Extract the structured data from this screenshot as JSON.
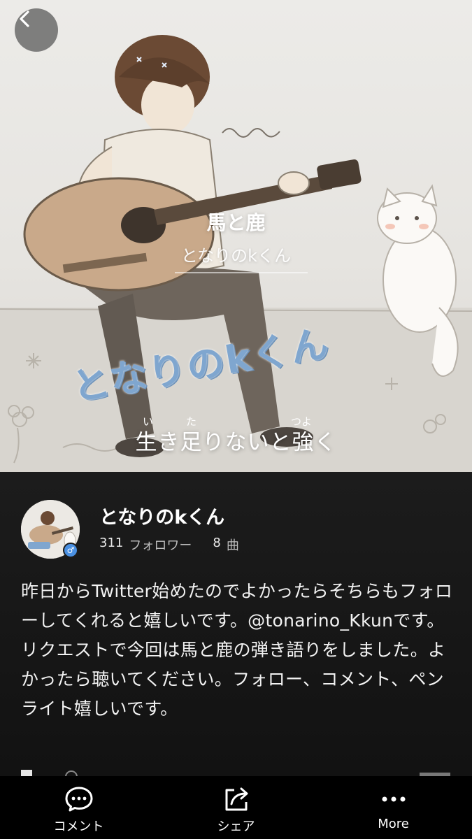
{
  "hero": {
    "song_title": "馬と鹿",
    "artist": "となりのkくん",
    "watermark": "となりのkくん",
    "lyric": "生き足りないと強く",
    "lyric_ruby": [
      "い",
      "た",
      "つよ"
    ]
  },
  "profile": {
    "name": "となりのkくん",
    "followers_count": "311",
    "followers_label": "フォロワー",
    "songs_count": "8",
    "songs_label": "曲",
    "gender_symbol": "♂",
    "description": "昨日からTwitter始めたのでよかったらそちらもフォローしてくれると嬉しいです。@tonarino_Kkunです。リクエストで今回は馬と鹿の弾き語りをしました。よかったら聴いてください。フォロー、コメント、ペンライト嬉しいです。"
  },
  "bottom_bar": {
    "comment_label": "コメント",
    "share_label": "シェア",
    "more_label": "More"
  },
  "icons": [
    "back-chevron-icon",
    "comment-icon",
    "share-icon",
    "more-icon"
  ],
  "colors": {
    "panel_bg": "#1c1c1c",
    "bar_bg": "#000000",
    "watermark": "#7fa6cf",
    "badge": "#4a90e2"
  }
}
